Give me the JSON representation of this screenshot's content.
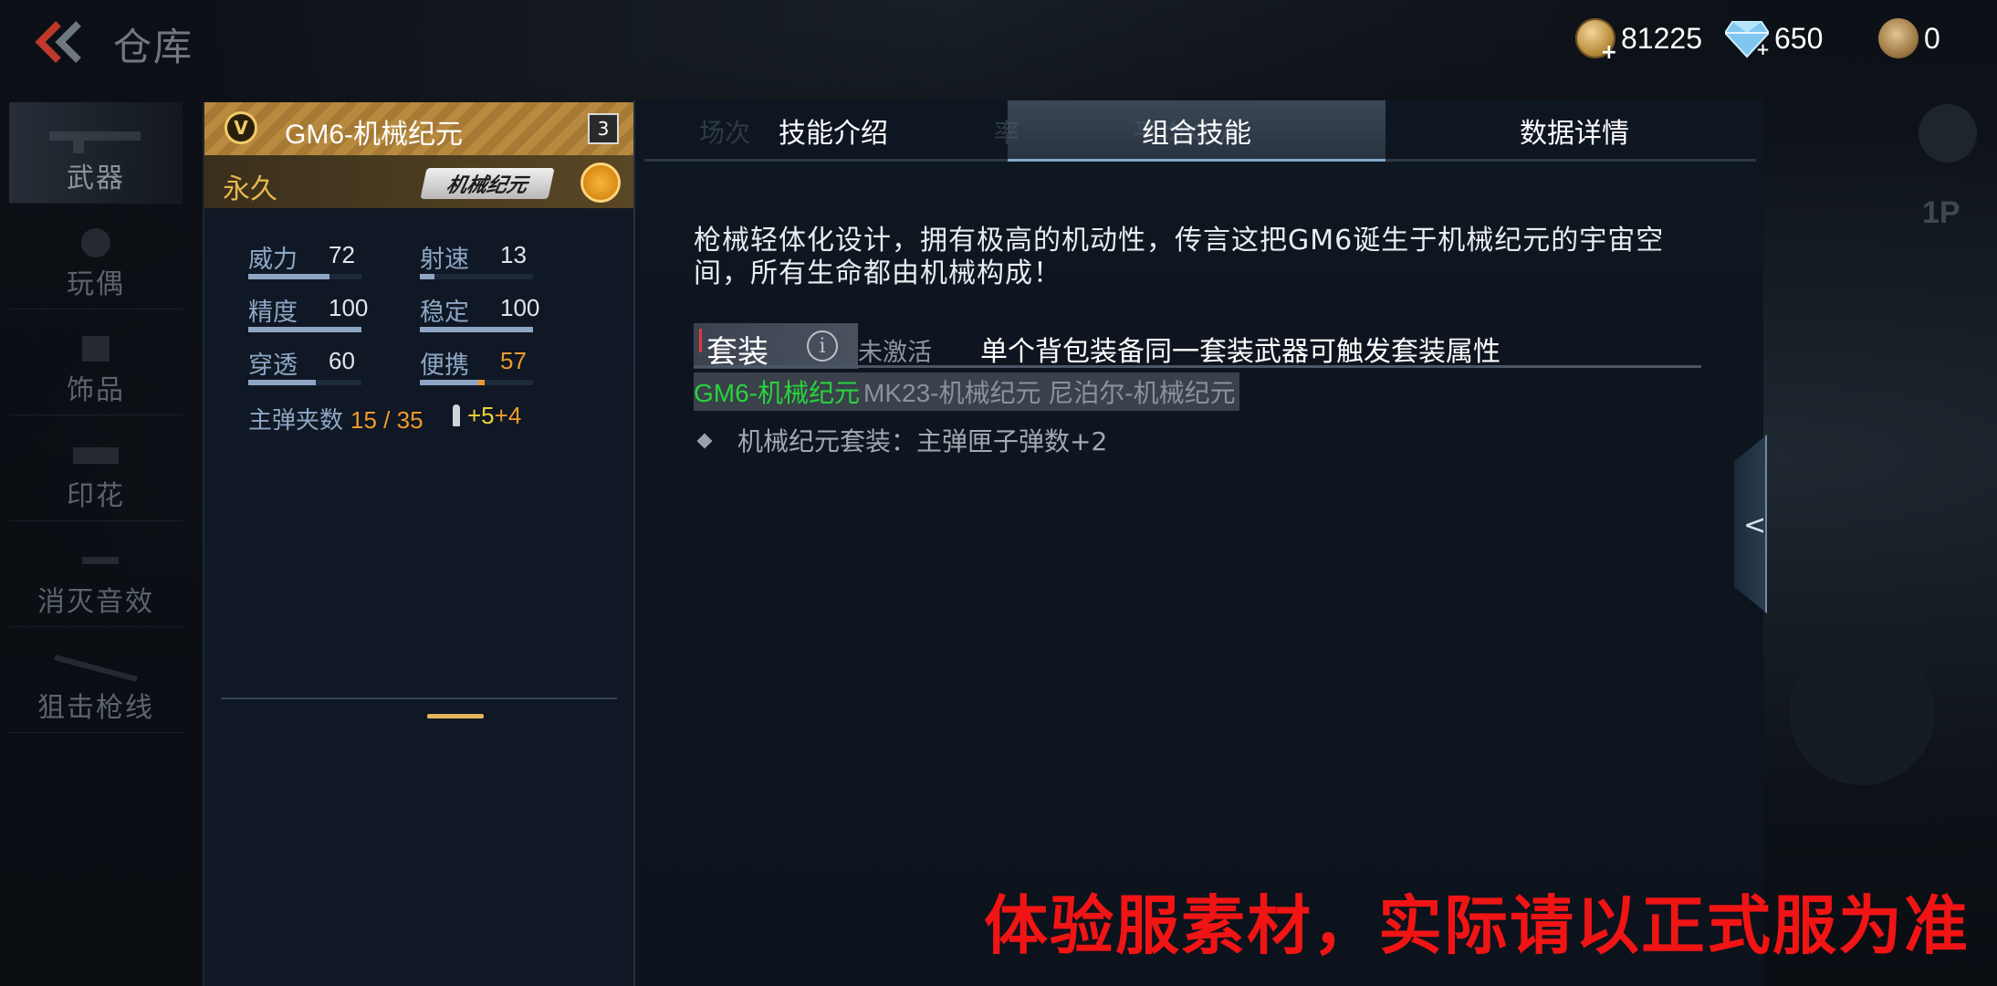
{
  "topbar": {
    "title": "仓库",
    "currencies": [
      {
        "icon": "gold-coin-icon",
        "amount": "81225"
      },
      {
        "icon": "diamond-icon",
        "amount": "650"
      },
      {
        "icon": "medal-coin-icon",
        "amount": "0"
      }
    ]
  },
  "sidebar": {
    "items": [
      {
        "label": "武器",
        "active": true
      },
      {
        "label": "玩偶",
        "active": false
      },
      {
        "label": "饰品",
        "active": false
      },
      {
        "label": "印花",
        "active": false
      },
      {
        "label": "消灭音效",
        "active": false
      },
      {
        "label": "狙击枪线",
        "active": false
      }
    ]
  },
  "weapon": {
    "name": "GM6-机械纪元",
    "level": "3",
    "duration": "永久",
    "logo_text": "机械纪元",
    "stats": [
      {
        "label": "威力",
        "value": "72",
        "fill": 0.72,
        "highlight": false
      },
      {
        "label": "射速",
        "value": "13",
        "fill": 0.13,
        "highlight": false
      },
      {
        "label": "精度",
        "value": "100",
        "fill": 1.0,
        "highlight": false
      },
      {
        "label": "稳定",
        "value": "100",
        "fill": 1.0,
        "highlight": false
      },
      {
        "label": "穿透",
        "value": "60",
        "fill": 0.6,
        "highlight": false
      },
      {
        "label": "便携",
        "value": "57",
        "fill": 0.57,
        "highlight": true
      }
    ],
    "ammo_label": "主弹夹数",
    "ammo_value": "15 / 35",
    "ammo_bonus_1": "+5",
    "ammo_bonus_2": "+4"
  },
  "info": {
    "ghost_row": "场次                              率              平均KDA",
    "tabs": [
      {
        "label": "技能介绍",
        "active": false
      },
      {
        "label": "组合技能",
        "active": true
      },
      {
        "label": "数据详情",
        "active": false
      }
    ],
    "description": "枪械轻体化设计，拥有极高的机动性，传言这把GM6诞生于机械纪元的宇宙空间，所有生命都由机械构成！",
    "set": {
      "name": "套装",
      "status": "未激活",
      "hint": "单个背包装备同一套装武器可触发套装属性",
      "owned_item": "GM6-机械纪元",
      "other_items": "MK23-机械纪元 尼泊尔-机械纪元",
      "bonus": "机械纪元套装：主弹匣子弹数+2"
    }
  },
  "side": {
    "pip_label": "1P"
  },
  "watermark": "体验服素材，实际请以正式服为准",
  "colors": {
    "owned_green": "#28d43c",
    "gold": "#b88a3f",
    "watermark_red": "#f01414",
    "stat_orange": "#f09a2c"
  }
}
